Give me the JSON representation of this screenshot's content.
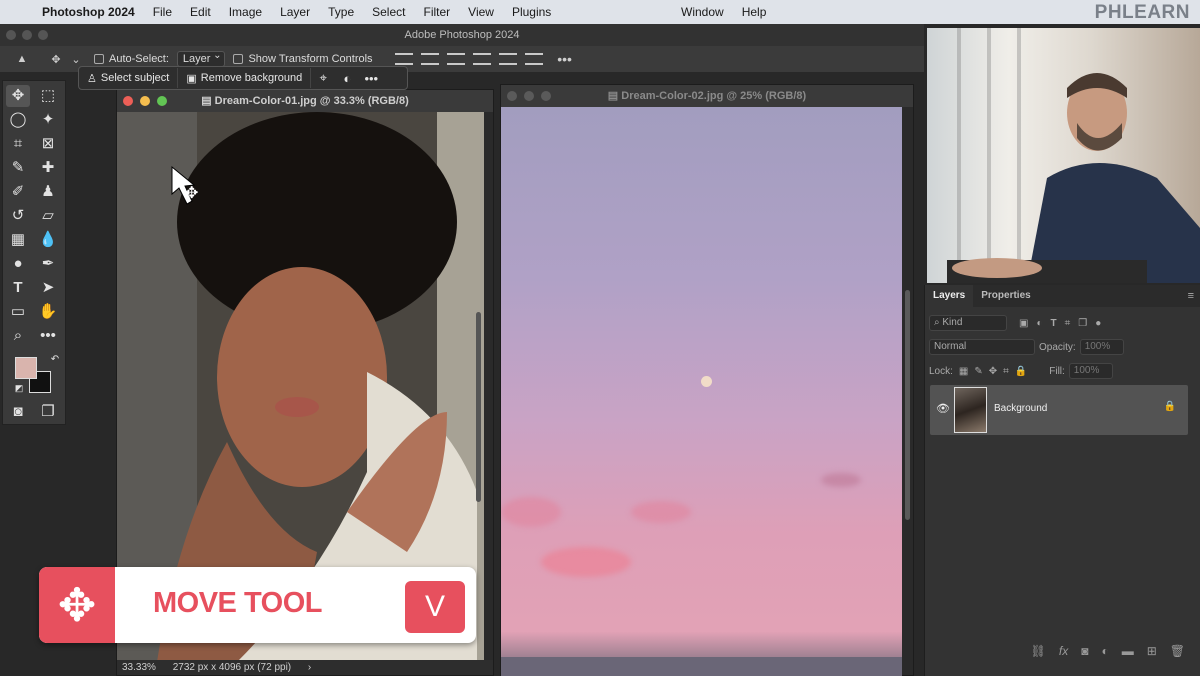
{
  "menubar": {
    "apple_icon": "apple-icon",
    "app_name": "Photoshop 2024",
    "items": [
      "File",
      "Edit",
      "Image",
      "Layer",
      "Type",
      "Select",
      "Filter",
      "View",
      "Plugins"
    ],
    "right_items": [
      "Window",
      "Help"
    ],
    "brand": "PHLEARN"
  },
  "window": {
    "title": "Adobe Photoshop 2024"
  },
  "options": {
    "auto_select_label": "Auto-Select:",
    "auto_select_value": "Layer",
    "show_transform_label": "Show Transform Controls"
  },
  "context_bar": {
    "select_subject": "Select subject",
    "remove_background": "Remove background"
  },
  "doc1": {
    "title": "Dream-Color-01.jpg @ 33.3% (RGB/8)",
    "zoom": "33.33%",
    "info": "2732 px x 4096 px (72 ppi)"
  },
  "doc2": {
    "title": "Dream-Color-02.jpg @ 25% (RGB/8)"
  },
  "layers_panel": {
    "tabs": [
      "Layers",
      "Properties"
    ],
    "filter_placeholder": "Kind",
    "blend_mode": "Normal",
    "opacity_label": "Opacity:",
    "opacity_value": "100%",
    "lock_label": "Lock:",
    "fill_label": "Fill:",
    "fill_value": "100%",
    "layer_name": "Background"
  },
  "overlay": {
    "tool_name": "MOVE TOOL",
    "shortcut": "V"
  },
  "colors": {
    "accent": "#e7505e",
    "foreground_swatch": "#d9b4ad",
    "background_swatch": "#111111"
  }
}
